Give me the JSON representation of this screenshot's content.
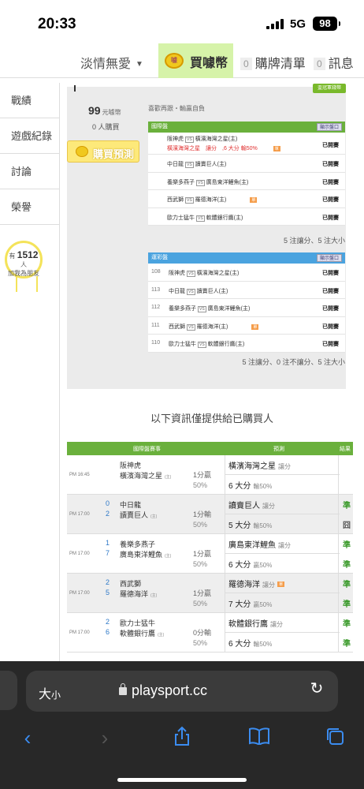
{
  "status_bar": {
    "time": "20:33",
    "network": "5G",
    "battery": "98"
  },
  "top_nav": {
    "user": "淡情無愛",
    "buy_coin": "買噱幣",
    "buy_list": {
      "count": "0",
      "label": "購牌清單"
    },
    "messages": {
      "count": "0",
      "label": "訊息"
    }
  },
  "sidebar": {
    "items": [
      "戰績",
      "遊戲紀錄",
      "討論",
      "榮譽"
    ],
    "fans": {
      "prefix": "有",
      "count": "1512",
      "suffix": "人",
      "caption": "加我為朋友"
    }
  },
  "seller": {
    "badge": "盃冠軍錢幣",
    "price": "99",
    "price_unit": "元噱幣",
    "buyers": "0 人購買",
    "predict_button": "購買預測",
    "note": "喜歡再跟・輸贏自負"
  },
  "intl_section": {
    "title": "國際盤",
    "show_button": "顯示盤口",
    "rows": [
      {
        "away": "阪神虎",
        "home": "橫濱海灣之星(主)",
        "pick": "橫濱海灣之星　讓分　,6 大分 輸50%",
        "tag": "單",
        "status": "已開賽"
      },
      {
        "away": "中日龍",
        "home": "讀賣巨人(主)",
        "status": "已開賽"
      },
      {
        "away": "養樂多燕子",
        "home": "廣島東洋鯉魚(主)",
        "status": "已開賽"
      },
      {
        "away": "西武獅",
        "home": "羅德海洋(主)",
        "tag": "單",
        "status": "已開賽"
      },
      {
        "away": "歐力士猛牛",
        "home": "軟體銀行鷹(主)",
        "status": "已開賽"
      }
    ],
    "summary": "5 注讓分、5 注大小"
  },
  "lottery_section": {
    "title": "運彩盤",
    "show_button": "顯示盤口",
    "rows": [
      {
        "num": "108",
        "away": "阪神虎",
        "home": "橫濱海灣之星(主)",
        "status": "已開賽"
      },
      {
        "num": "113",
        "away": "中日龍",
        "home": "讀賣巨人(主)",
        "status": "已開賽"
      },
      {
        "num": "112",
        "away": "養樂多燕子",
        "home": "廣島東洋鯉魚(主)",
        "status": "已開賽"
      },
      {
        "num": "111",
        "away": "西武獅",
        "home": "羅德海洋(主)",
        "tag": "單",
        "status": "已開賽"
      },
      {
        "num": "110",
        "away": "歐力士猛牛",
        "home": "軟體銀行鷹(主)",
        "status": "已開賽"
      }
    ],
    "summary": "5 注讓分、0 注不讓分、5 注大小"
  },
  "info_text": "以下資訊僅提供給已購買人",
  "result_table": {
    "headers": {
      "match": "國際盤賽事",
      "predict": "預測",
      "result": "結果"
    },
    "rows": [
      {
        "time": "PM 16:45",
        "away_score": "",
        "away": "阪神虎",
        "home_score": "",
        "home": "橫濱海灣之星",
        "home_mark": "(主)",
        "line1": "1分贏",
        "line2": "50%",
        "pick1": "橫濱海灣之星",
        "pick1_sub": "讓分",
        "pick2": "6 大分",
        "pick2_sub": "輸50%",
        "r1": "",
        "r2": ""
      },
      {
        "time": "PM 17:00",
        "away_score": "0",
        "away": "中日龍",
        "home_score": "2",
        "home": "讀賣巨人",
        "home_mark": "(主)",
        "line1": "1分輸",
        "line2": "50%",
        "pick1": "讀賣巨人",
        "pick1_sub": "讓分",
        "pick2": "5 大分",
        "pick2_sub": "輸50%",
        "r1": "準",
        "r2": "囧"
      },
      {
        "time": "PM 17:00",
        "away_score": "1",
        "away": "養樂多燕子",
        "home_score": "7",
        "home": "廣島東洋鯉魚",
        "home_mark": "(主)",
        "line1": "1分贏",
        "line2": "50%",
        "pick1": "廣島東洋鯉魚",
        "pick1_sub": "讓分",
        "pick2": "6 大分",
        "pick2_sub": "贏50%",
        "r1": "準",
        "r2": "準"
      },
      {
        "time": "PM 17:00",
        "away_score": "2",
        "away": "西武獅",
        "home_score": "5",
        "home": "羅德海洋",
        "home_mark": "(主)",
        "line1": "1分贏",
        "line2": "50%",
        "pick1": "羅德海洋",
        "pick1_sub": "讓分",
        "pick1_tag": "單",
        "pick2": "7 大分",
        "pick2_sub": "贏50%",
        "r1": "準",
        "r2": "準"
      },
      {
        "time": "PM 17:00",
        "away_score": "2",
        "away": "歐力士猛牛",
        "home_score": "6",
        "home": "軟體銀行鷹",
        "home_mark": "(主)",
        "line1": "0分輸",
        "line2": "50%",
        "pick1": "軟體銀行鷹",
        "pick1_sub": "讓分",
        "pick2": "6 大分",
        "pick2_sub": "輸50%",
        "r1": "準",
        "r2": "準"
      }
    ]
  },
  "browser": {
    "text_size": "大",
    "text_size_small": "小",
    "url": "playsport.cc"
  },
  "colors": {
    "green_header": "#6ab03c",
    "blue_header": "#4aa3df",
    "buy_bg": "#d6f3a9",
    "win": "#3a9a2a"
  }
}
